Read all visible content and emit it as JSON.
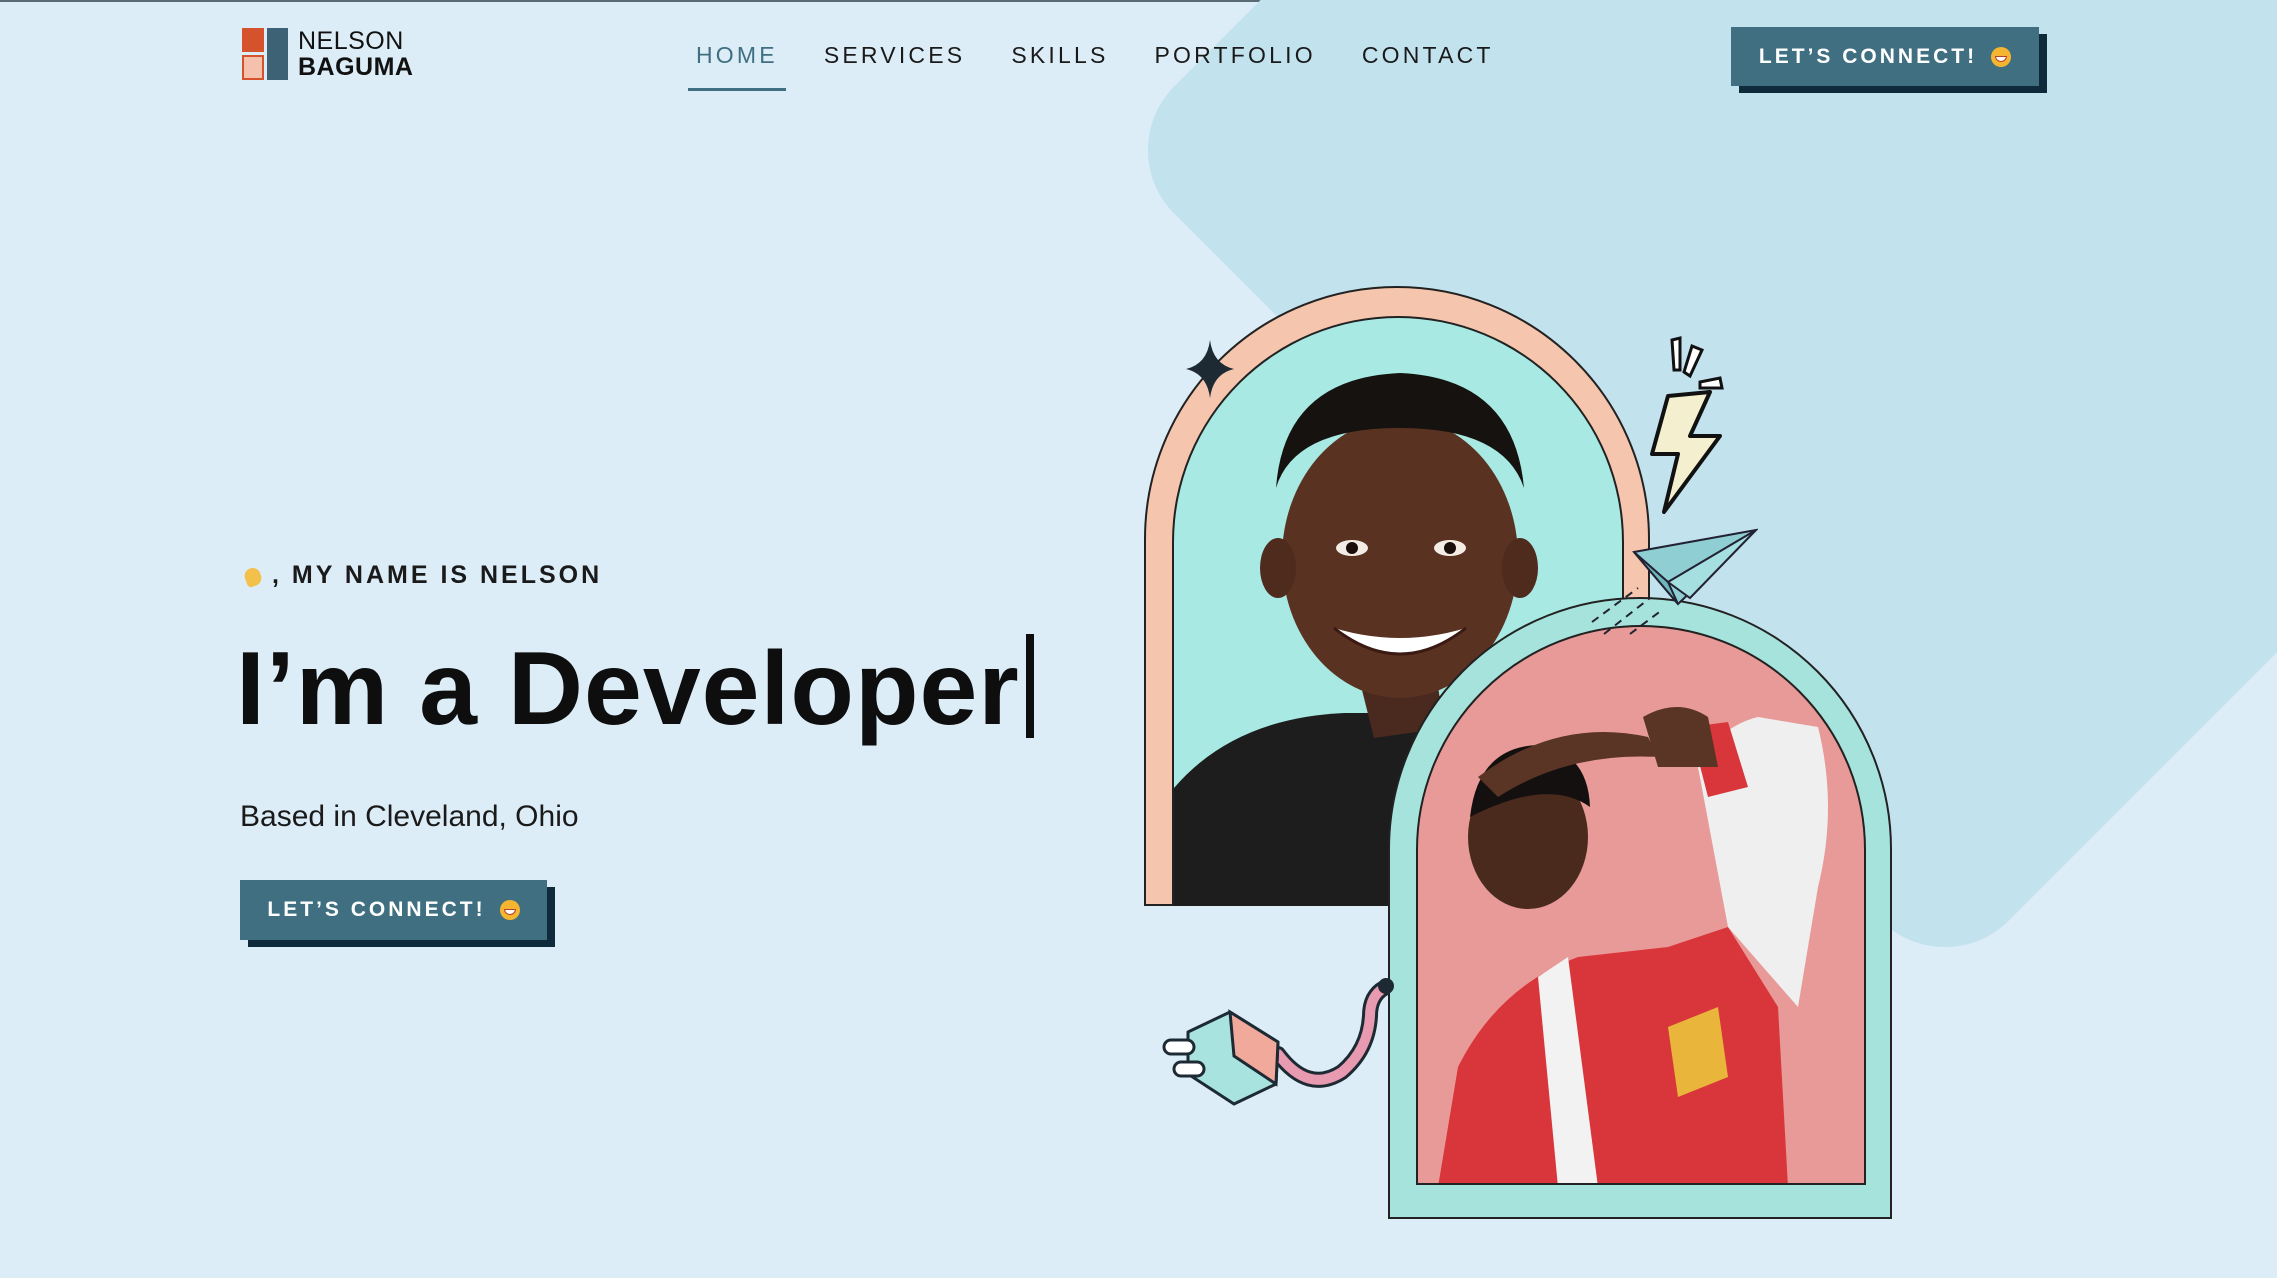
{
  "header": {
    "logo": {
      "line1": "NELSON",
      "line2": "BAGUMA"
    },
    "nav": [
      {
        "label": "HOME",
        "active": true
      },
      {
        "label": "SERVICES",
        "active": false
      },
      {
        "label": "SKILLS",
        "active": false
      },
      {
        "label": "PORTFOLIO",
        "active": false
      },
      {
        "label": "CONTACT",
        "active": false
      }
    ],
    "cta_label": "LET’S CONNECT!"
  },
  "hero": {
    "greeting": ", MY NAME IS NELSON",
    "headline": "I’m a Developer",
    "location": "Based in Cleveland, Ohio",
    "cta_label": "LET’S CONNECT!"
  },
  "icons": {
    "greeting_icon": "waving-hand-icon",
    "cta_icon": "grinning-face-icon",
    "sparkle": "sparkle-icon",
    "lightning": "lightning-bolt-icon",
    "plane": "paper-plane-icon",
    "plug": "power-plug-icon"
  },
  "colors": {
    "background": "#dcedf7",
    "diamond": "#c2e2ee",
    "accent": "#3f6f80",
    "button_shadow": "#0f2a3a",
    "arch_peach": "#f6c5ad",
    "arch_mint": "#a8e9e3",
    "arch_pink": "#e79a97",
    "logo_orange": "#d4532c",
    "logo_blue": "#3d6275"
  }
}
